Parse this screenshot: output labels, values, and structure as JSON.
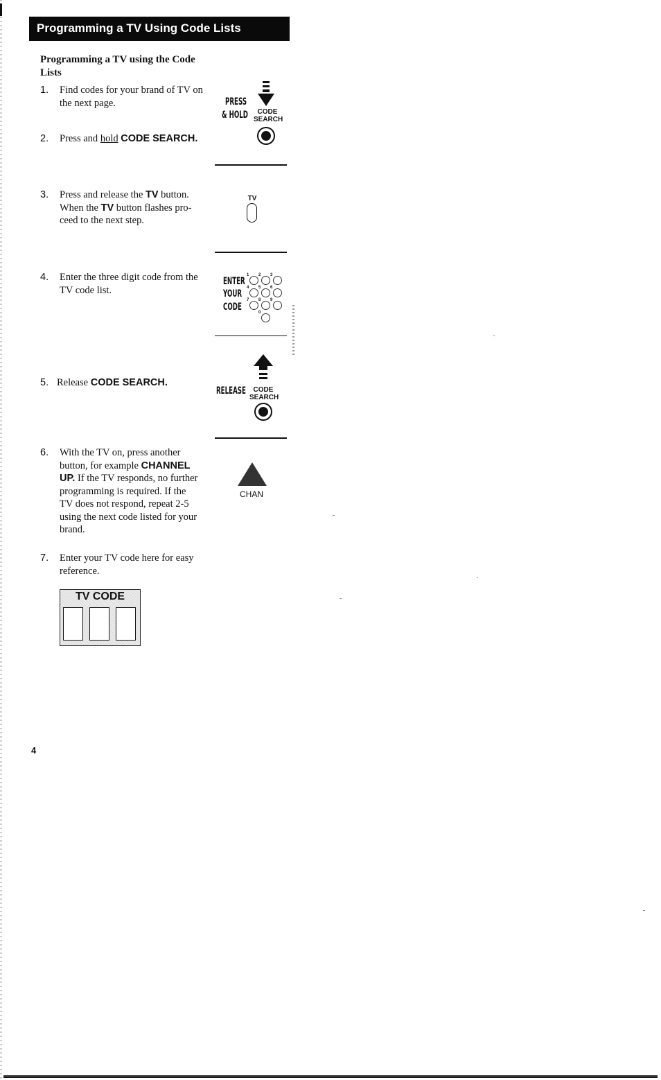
{
  "header": {
    "title": "Programming a TV Using Code Lists"
  },
  "subtitle": "Programming a TV using the Code Lists",
  "steps": [
    {
      "number": "1.",
      "text": "Find codes for your brand of TV on the next page."
    },
    {
      "number": "2.",
      "text_before": "Press and ",
      "text_underlined": "hold",
      "text_bold": "CODE SEARCH."
    },
    {
      "number": "3.",
      "line1_before": "Press and release the ",
      "line1_bold": "TV",
      "line1_after": " button.",
      "line2_before": "When the ",
      "line2_bold": "TV",
      "line2_after": " button flashes pro-",
      "line3": "ceed to the next step."
    },
    {
      "number": "4.",
      "text": "Enter the three digit code from the TV code list."
    },
    {
      "number": "5.",
      "text_before": "Release ",
      "text_bold": "CODE SEARCH."
    },
    {
      "number": "6.",
      "text_before": "With the TV on, press another button, for example ",
      "text_bold": "CHANNEL UP.",
      "text_after": " If the TV responds, no further programming is required. If the TV does not respond, repeat 2-5 using the next code listed for your brand."
    },
    {
      "number": "7.",
      "text": "Enter your TV code here for easy reference."
    }
  ],
  "illustrations": {
    "press_hold": {
      "label_line1": "PRESS",
      "label_line2": "& HOLD",
      "button_label_line1": "CODE",
      "button_label_line2": "SEARCH",
      "arrow_icon": "arrow-down-icon"
    },
    "tv_button": {
      "label": "TV"
    },
    "enter_code": {
      "label_line1": "ENTER",
      "label_line2": "YOUR",
      "label_line3": "CODE",
      "keys": [
        "1",
        "2",
        "3",
        "4",
        "5",
        "6",
        "7",
        "8",
        "9",
        "0"
      ]
    },
    "release": {
      "label": "RELEASE",
      "button_label_line1": "CODE",
      "button_label_line2": "SEARCH",
      "arrow_icon": "arrow-up-icon"
    },
    "channel_up": {
      "label": "CHAN",
      "icon": "triangle-up-icon"
    }
  },
  "tv_code_box": {
    "title": "TV CODE",
    "cells": [
      "",
      "",
      ""
    ]
  },
  "page_number": "4"
}
